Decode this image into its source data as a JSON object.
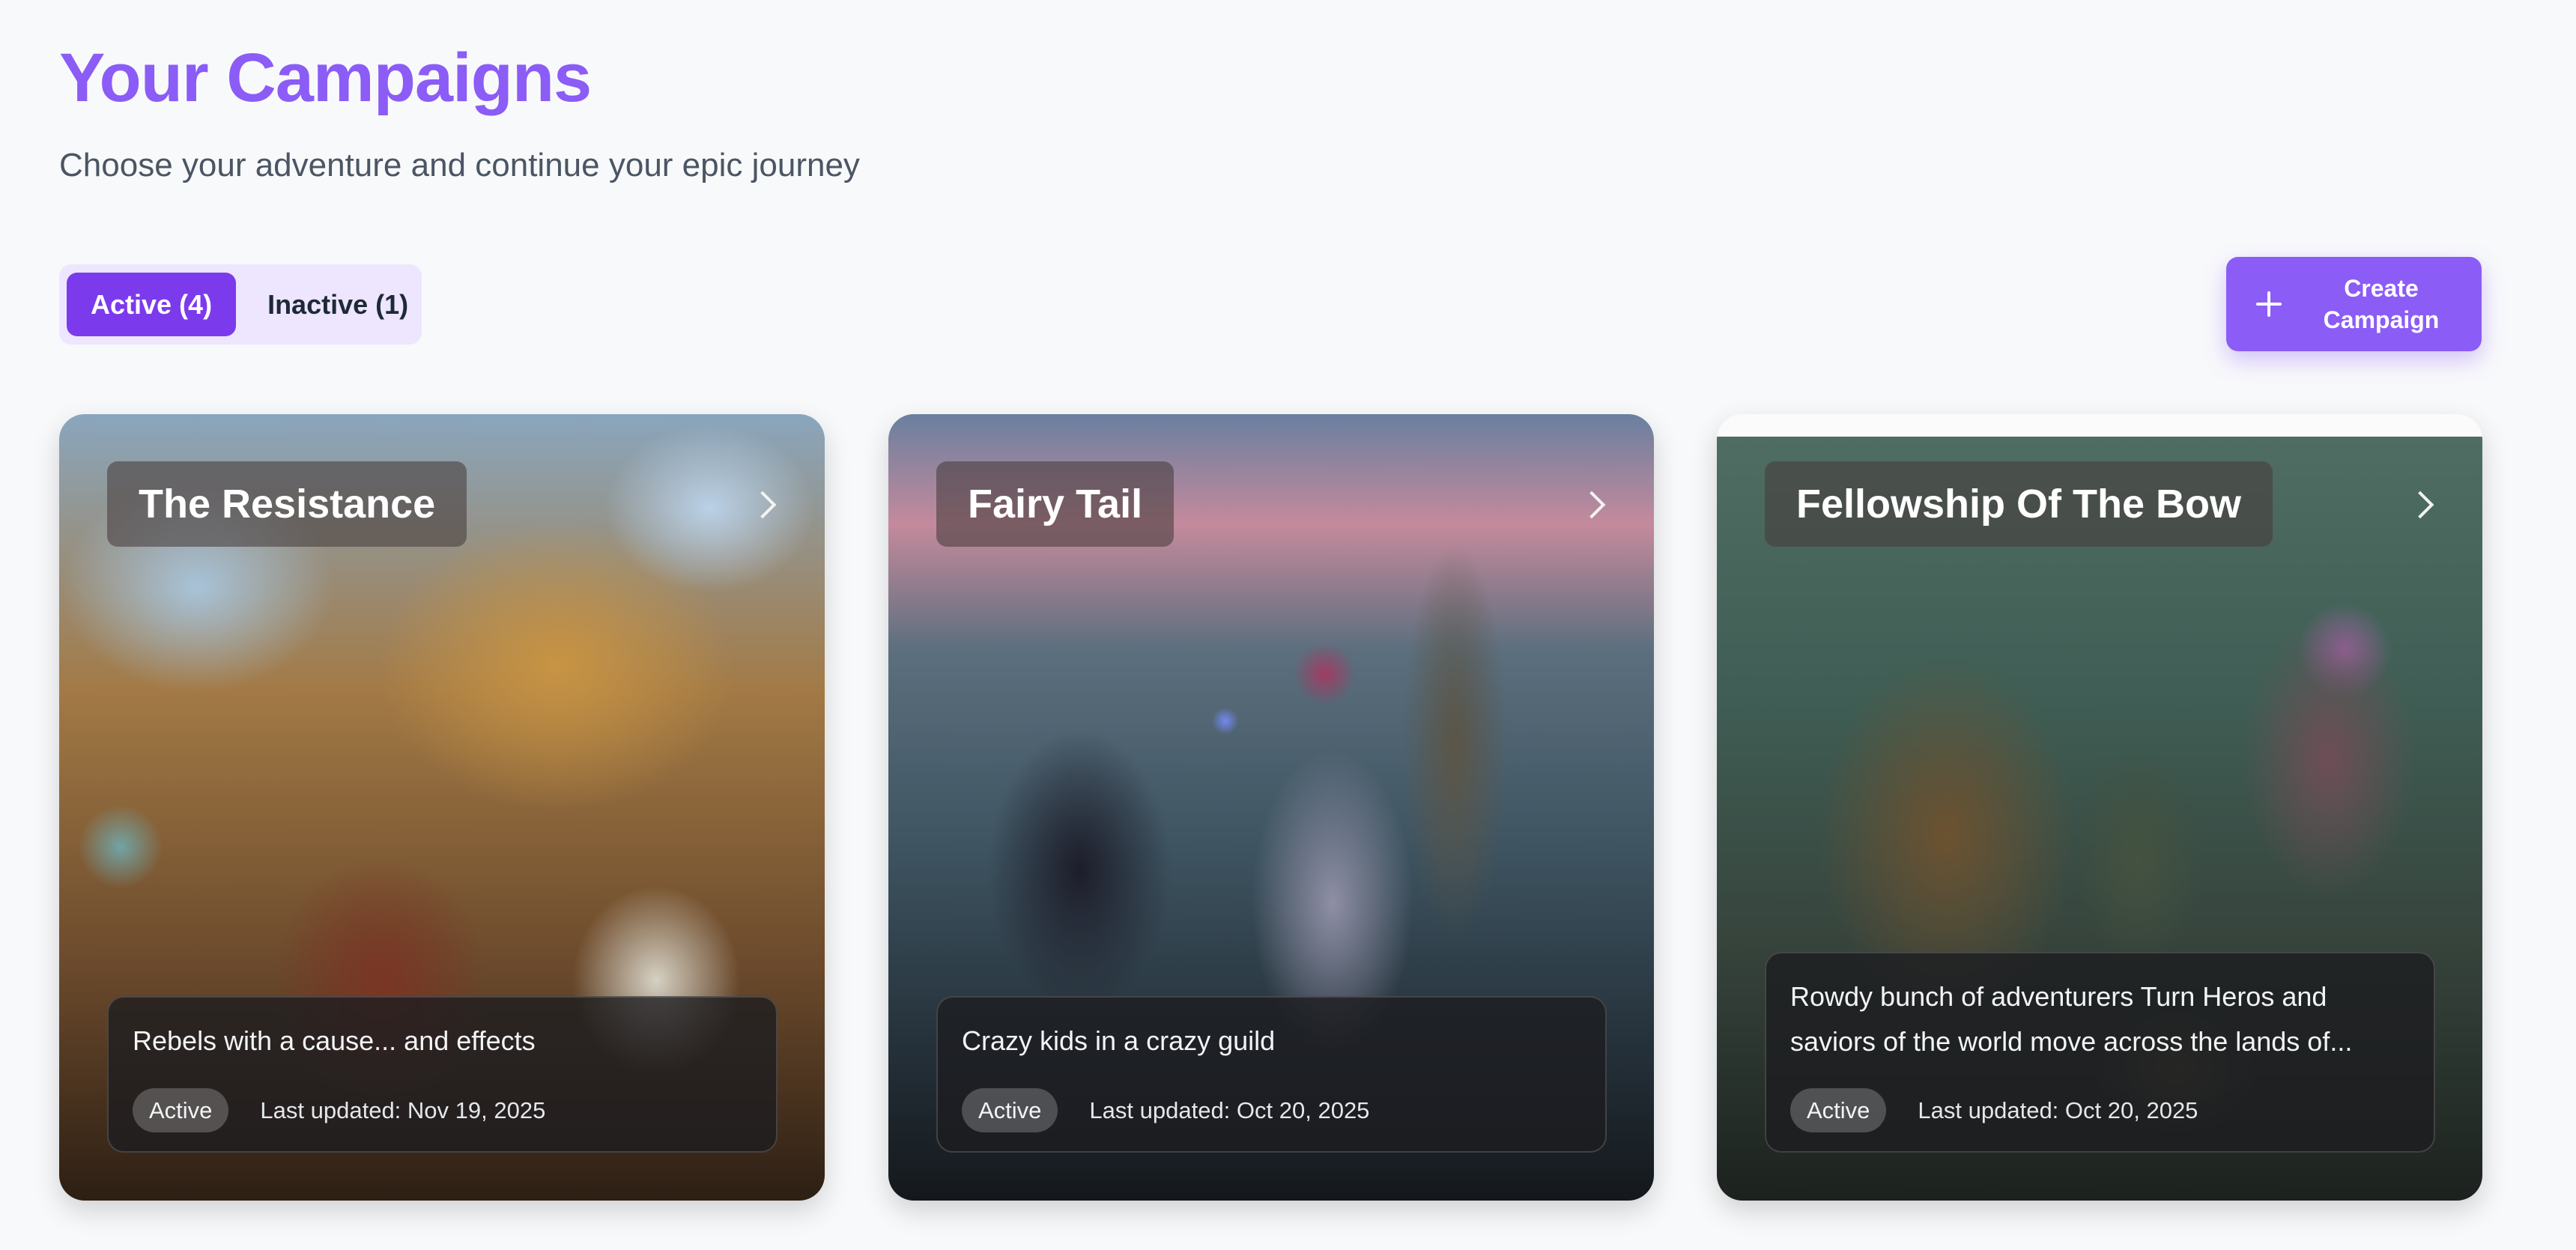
{
  "header": {
    "title": "Your Campaigns",
    "subtitle": "Choose your adventure and continue your epic journey"
  },
  "tabs": [
    {
      "label": "Active (4)",
      "selected": true
    },
    {
      "label": "Inactive (1)",
      "selected": false
    }
  ],
  "create_button": {
    "label": "Create Campaign",
    "icon": "plus-icon"
  },
  "campaigns": [
    {
      "title": "The Resistance",
      "description": "Rebels with a cause... and effects",
      "status": "Active",
      "last_updated": "Last updated: Nov 19, 2025"
    },
    {
      "title": "Fairy Tail",
      "description": "Crazy kids in a crazy guild",
      "status": "Active",
      "last_updated": "Last updated: Oct 20, 2025"
    },
    {
      "title": "Fellowship Of The Bow",
      "description": "Rowdy bunch of adventurers Turn Heros and saviors of the world move across the lands of...",
      "status": "Active",
      "last_updated": "Last updated: Oct 20, 2025"
    }
  ],
  "colors": {
    "accent": "#8b5cf6",
    "tab_active": "#7c3aed",
    "tabs_bg": "#ede6fe",
    "page_bg": "#f8f9fb"
  }
}
